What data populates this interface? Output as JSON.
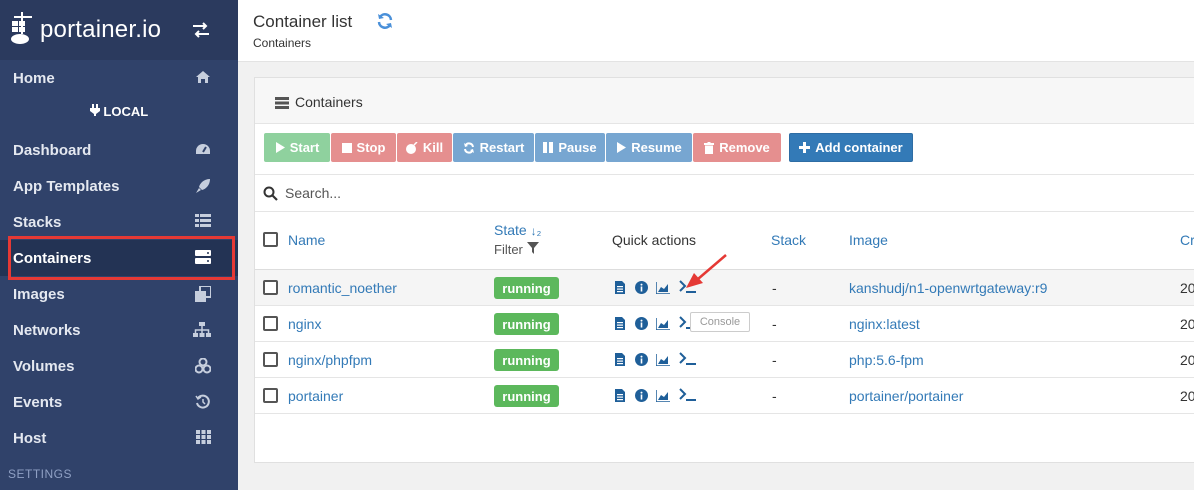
{
  "brand": {
    "logo_text": "portainer.io"
  },
  "sidebar": {
    "endpoint": "LOCAL",
    "items": [
      {
        "label": "Home",
        "icon": "home-icon"
      },
      {
        "label": "Dashboard",
        "icon": "tachometer-icon"
      },
      {
        "label": "App Templates",
        "icon": "rocket-icon"
      },
      {
        "label": "Stacks",
        "icon": "th-list-icon"
      },
      {
        "label": "Containers",
        "icon": "server-icon",
        "active": true
      },
      {
        "label": "Images",
        "icon": "clone-icon"
      },
      {
        "label": "Networks",
        "icon": "sitemap-icon"
      },
      {
        "label": "Volumes",
        "icon": "cubes-icon"
      },
      {
        "label": "Events",
        "icon": "history-icon"
      },
      {
        "label": "Host",
        "icon": "th-icon"
      }
    ],
    "settings_label": "SETTINGS"
  },
  "header": {
    "title": "Container list",
    "breadcrumb": "Containers"
  },
  "widget": {
    "title": "Containers",
    "buttons": {
      "start": "Start",
      "stop": "Stop",
      "kill": "Kill",
      "restart": "Restart",
      "pause": "Pause",
      "resume": "Resume",
      "remove": "Remove",
      "add": "Add container"
    },
    "search": {
      "placeholder": "Search..."
    },
    "columns": {
      "name": "Name",
      "state": "State",
      "state_sort": "↓₂",
      "filter": "Filter",
      "quick_actions": "Quick actions",
      "stack": "Stack",
      "image": "Image",
      "created": "Cr"
    },
    "rows": [
      {
        "name": "romantic_noether",
        "state": "running",
        "stack": "-",
        "image": "kanshudj/n1-openwrtgateway:r9",
        "created": "20"
      },
      {
        "name": "nginx",
        "state": "running",
        "stack": "-",
        "image": "nginx:latest",
        "created": "20"
      },
      {
        "name": "nginx/phpfpm",
        "state": "running",
        "stack": "-",
        "image": "php:5.6-fpm",
        "created": "20"
      },
      {
        "name": "portainer",
        "state": "running",
        "stack": "-",
        "image": "portainer/portainer",
        "created": "20"
      }
    ],
    "tooltip": "Console"
  },
  "colors": {
    "sidebar_bg": "#30426a",
    "running_badge": "#5cb85c",
    "link": "#337ab7",
    "annotation": "#e53935"
  }
}
